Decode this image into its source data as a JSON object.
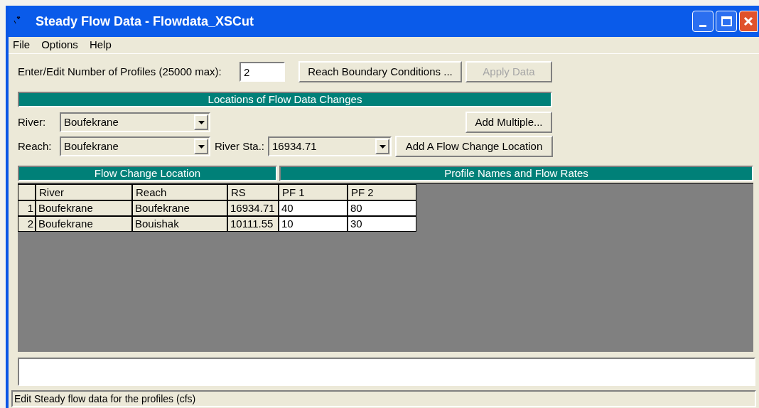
{
  "window": {
    "title": "Steady Flow Data - Flowdata_XSCut"
  },
  "menu": [
    "File",
    "Options",
    "Help"
  ],
  "profiles": {
    "label": "Enter/Edit Number of Profiles (25000 max):",
    "value": "2"
  },
  "top_buttons": [
    {
      "label": "Reach Boundary Conditions ...",
      "disabled": false
    },
    {
      "label": "Apply Data",
      "disabled": true
    }
  ],
  "locations": {
    "title": "Locations of Flow Data Changes",
    "river": {
      "label": "River:",
      "value": "Boufekrane"
    },
    "reach": {
      "label": "Reach:",
      "value": "Boufekrane"
    },
    "river_sta": {
      "label": "River Sta.:",
      "value": "16934.71"
    },
    "add_multiple": {
      "label": "Add Multiple...",
      "disabled": false
    },
    "add_location": {
      "label": "Add A Flow Change Location",
      "disabled": false
    }
  },
  "table": {
    "group_headers": [
      "Flow Change Location",
      "Profile Names and Flow Rates"
    ],
    "columns": [
      "River",
      "Reach",
      "RS",
      "PF 1",
      "PF 2"
    ],
    "rows": [
      {
        "number": "1",
        "cells": [
          "Boufekrane",
          "Boufekrane",
          "16934.71",
          "40",
          "80"
        ]
      },
      {
        "number": "2",
        "cells": [
          "Boufekrane",
          "Bouishak",
          "10111.55",
          "10",
          "30"
        ]
      }
    ]
  },
  "status_bar": "Edit Steady flow data for the profiles (cfs)"
}
